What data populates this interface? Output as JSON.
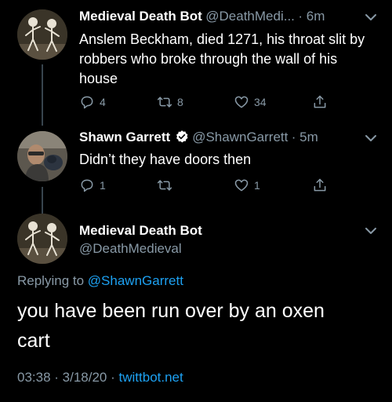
{
  "tweet1": {
    "name": "Medieval Death Bot",
    "handle": "@DeathMedi...",
    "time": "· 6m",
    "text": "Anslem Beckham, died 1271, his throat slit by robbers who broke through the wall of his house",
    "replies": "4",
    "retweets": "8",
    "likes": "34"
  },
  "tweet2": {
    "name": "Shawn Garrett",
    "handle": "@ShawnGarrett",
    "time": "· 5m",
    "text": "Didn’t they have doors then",
    "replies": "1",
    "retweets": "",
    "likes": "1"
  },
  "tweet3": {
    "name": "Medieval Death Bot",
    "handle": "@DeathMedieval",
    "replying_prefix": "Replying to",
    "replying_handle": "@ShawnGarrett",
    "text": "you have been run over by an oxen cart",
    "time": "03:38",
    "date": "· 3/18/20 ·",
    "source": "twittbot.net"
  },
  "colors": {
    "background": "#000000",
    "text": "#ffffff",
    "secondary": "#8899a6",
    "link": "#1da1f2",
    "thread_line": "#38444d"
  }
}
